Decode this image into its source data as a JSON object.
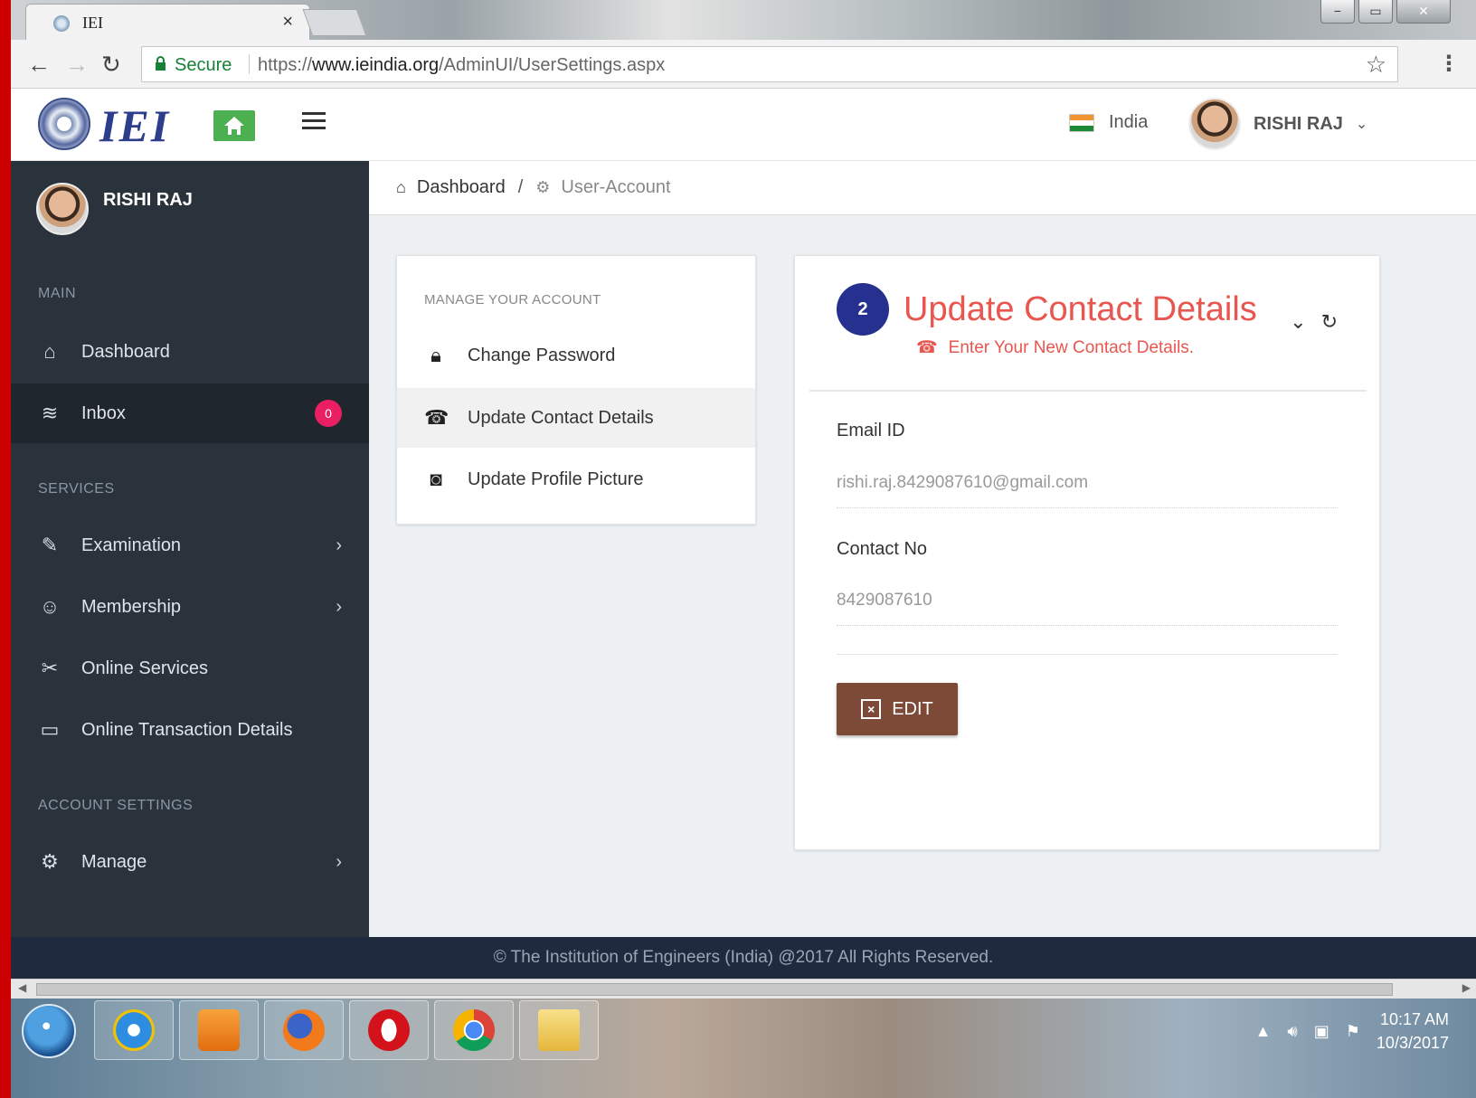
{
  "browser": {
    "tab_title": "IEI",
    "tab_close": "×",
    "secure_label": "Secure",
    "url_scheme": "https://",
    "url_host": "www.ieindia.org",
    "url_path": "/AdminUI/UserSettings.aspx",
    "window_buttons": [
      "−",
      "▭",
      "✕"
    ]
  },
  "header": {
    "logo_text": "IEI",
    "country": "India",
    "user_name": "RISHI RAJ",
    "caret": "⌄"
  },
  "sidebar": {
    "user_name": "RISHI RAJ",
    "sections": {
      "main": "MAIN",
      "services": "SERVICES",
      "account": "ACCOUNT SETTINGS"
    },
    "items": [
      {
        "label": "Dashboard",
        "icon": "home-outline-icon"
      },
      {
        "label": "Inbox",
        "icon": "layers-icon",
        "badge": "0"
      },
      {
        "label": "Examination",
        "icon": "pencil-icon"
      },
      {
        "label": "Membership",
        "icon": "users-icon"
      },
      {
        "label": "Online Services",
        "icon": "tools-icon"
      },
      {
        "label": "Online Transaction Details",
        "icon": "credit-card-icon"
      },
      {
        "label": "Manage",
        "icon": "gear-icon"
      }
    ]
  },
  "breadcrumb": {
    "home": "Dashboard",
    "separator": "/",
    "current": "User-Account"
  },
  "manage_card": {
    "heading": "MANAGE YOUR ACCOUNT",
    "items": [
      {
        "label": "Change Password",
        "icon": "lock-icon"
      },
      {
        "label": "Update Contact Details",
        "icon": "phone-icon"
      },
      {
        "label": "Update Profile Picture",
        "icon": "camera-icon"
      }
    ]
  },
  "update_card": {
    "step": "2",
    "title": "Update Contact Details",
    "subtitle": "Enter Your New Contact Details.",
    "email_label": "Email ID",
    "email_value": "rishi.raj.8429087610@gmail.com",
    "contact_label": "Contact No",
    "contact_value": "8429087610",
    "edit_label": "EDIT"
  },
  "footer": {
    "text": "© The Institution of Engineers (India) @2017 All Rights Reserved."
  },
  "taskbar": {
    "time": "10:17 AM",
    "date": "10/3/2017"
  },
  "colors": {
    "sidebar_bg": "#2a323c",
    "accent_red": "#e8564f",
    "step_blue": "#25308f",
    "edit_brown": "#7d4a38",
    "footer_bg": "#1f2a3e",
    "badge_pink": "#e91e63",
    "home_green": "#4caf50"
  }
}
